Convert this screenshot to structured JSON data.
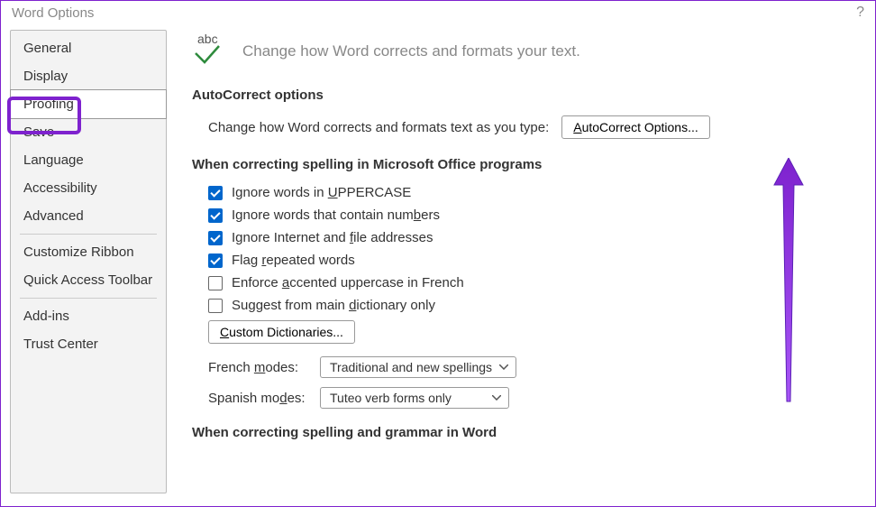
{
  "title": "Word Options",
  "sidebar": {
    "items": [
      {
        "label": "General"
      },
      {
        "label": "Display"
      },
      {
        "label": "Proofing",
        "selected": true
      },
      {
        "label": "Save"
      },
      {
        "label": "Language"
      },
      {
        "label": "Accessibility"
      },
      {
        "label": "Advanced"
      },
      {
        "label": "Customize Ribbon"
      },
      {
        "label": "Quick Access Toolbar"
      },
      {
        "label": "Add-ins"
      },
      {
        "label": "Trust Center"
      }
    ]
  },
  "main": {
    "hero_text": "Change how Word corrects and formats your text.",
    "abc_label": "abc",
    "section_autocorrect": "AutoCorrect options",
    "autocorrect_prompt": "Change how Word corrects and formats text as you type:",
    "autocorrect_btn": "AutoCorrect Options...",
    "section_spelling": "When correcting spelling in Microsoft Office programs",
    "checks": [
      {
        "label_pre": "Ignore words in ",
        "u": "U",
        "label_post": "PPERCASE",
        "checked": true
      },
      {
        "label_pre": "Ignore words that contain num",
        "u": "b",
        "label_post": "ers",
        "checked": true
      },
      {
        "label_pre": "Ignore Internet and ",
        "u": "f",
        "label_post": "ile addresses",
        "checked": true
      },
      {
        "label_pre": "Flag ",
        "u": "r",
        "label_post": "epeated words",
        "checked": true
      },
      {
        "label_pre": "Enforce ",
        "u": "a",
        "label_post": "ccented uppercase in French",
        "checked": false
      },
      {
        "label_pre": "Suggest from main ",
        "u": "d",
        "label_post": "ictionary only",
        "checked": false
      }
    ],
    "custom_dict_btn": "Custom Dictionaries...",
    "french_modes_label": "French modes:",
    "french_modes_value": "Traditional and new spellings",
    "spanish_modes_label": "Spanish modes:",
    "spanish_modes_value": "Tuteo verb forms only",
    "section_grammar": "When correcting spelling and grammar in Word"
  }
}
